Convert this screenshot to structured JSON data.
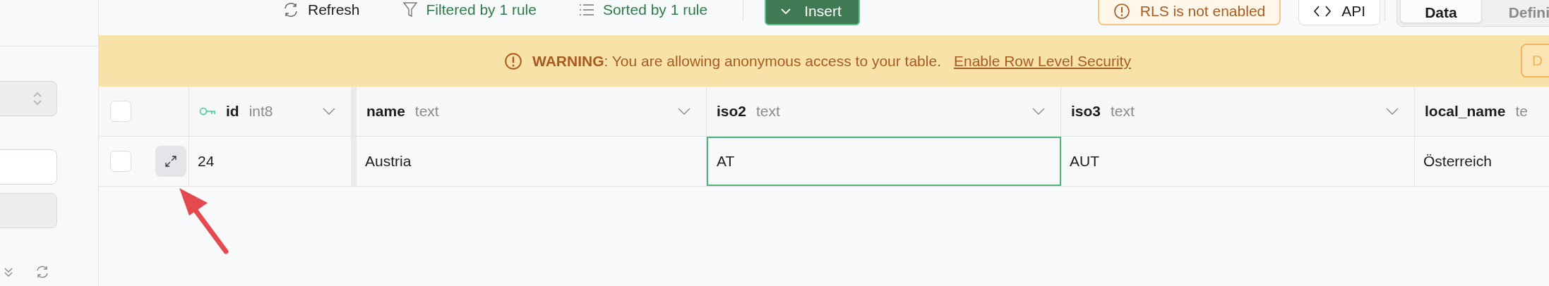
{
  "toolbar": {
    "refresh": "Refresh",
    "filter": "Filtered by 1 rule",
    "sort": "Sorted by 1 rule",
    "insert": "Insert",
    "rls_badge": "RLS is not enabled",
    "api": "API",
    "view_tabs": [
      {
        "label": "Data",
        "selected": true
      },
      {
        "label": "Defini",
        "selected": false
      }
    ]
  },
  "banner": {
    "message": "**WARNING**: You are allowing anonymous access to your table.",
    "link": "Enable Row Level Security",
    "button": "D"
  },
  "table": {
    "select_all_checked": false,
    "columns": [
      {
        "name": "id",
        "type": "int8",
        "primary_key": true
      },
      {
        "name": "name",
        "type": "text",
        "primary_key": false
      },
      {
        "name": "iso2",
        "type": "text",
        "primary_key": false
      },
      {
        "name": "iso3",
        "type": "text",
        "primary_key": false
      },
      {
        "name": "local_name",
        "type": "te",
        "primary_key": false
      }
    ],
    "rows": [
      {
        "selected": false,
        "cells": [
          {
            "value": "24",
            "focused": false
          },
          {
            "value": "Austria",
            "focused": false
          },
          {
            "value": "AT",
            "focused": true
          },
          {
            "value": "AUT",
            "focused": false
          },
          {
            "value": "Österreich",
            "focused": false
          }
        ]
      }
    ]
  }
}
